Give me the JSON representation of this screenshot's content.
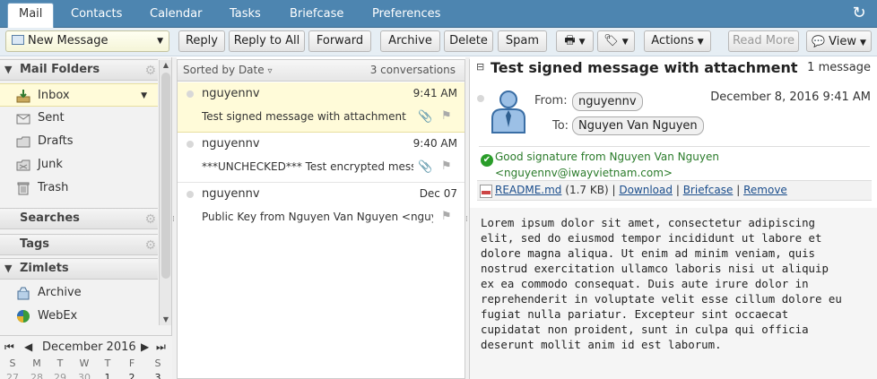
{
  "tabs": [
    "Mail",
    "Contacts",
    "Calendar",
    "Tasks",
    "Briefcase",
    "Preferences"
  ],
  "toolbar": {
    "new_message": "New Message",
    "reply": "Reply",
    "reply_all": "Reply to All",
    "forward": "Forward",
    "archive": "Archive",
    "delete": "Delete",
    "spam": "Spam",
    "actions": "Actions",
    "read_more": "Read More",
    "view": "View"
  },
  "sidebar": {
    "mail_folders": "Mail Folders",
    "folders": [
      {
        "label": "Inbox",
        "icon": "inbox-icon"
      },
      {
        "label": "Sent",
        "icon": "sent-icon"
      },
      {
        "label": "Drafts",
        "icon": "drafts-icon"
      },
      {
        "label": "Junk",
        "icon": "junk-icon"
      },
      {
        "label": "Trash",
        "icon": "trash-icon"
      }
    ],
    "searches": "Searches",
    "tags": "Tags",
    "zimlets": "Zimlets",
    "zimlet_items": [
      {
        "label": "Archive",
        "icon": "archive-zimlet-icon"
      },
      {
        "label": "WebEx",
        "icon": "webex-icon"
      }
    ]
  },
  "calendar": {
    "month": "December 2016",
    "days": [
      "S",
      "M",
      "T",
      "W",
      "T",
      "F",
      "S"
    ],
    "first_row": [
      "27",
      "28",
      "29",
      "30",
      "1",
      "2",
      "3"
    ]
  },
  "list": {
    "sort_label": "Sorted by Date",
    "count": "3 conversations",
    "messages": [
      {
        "from": "nguyennv",
        "time": "9:41 AM",
        "subject": "Test signed message with attachment",
        "attachment": true
      },
      {
        "from": "nguyennv",
        "time": "9:40 AM",
        "subject": "***UNCHECKED*** Test encrypted message with attachment",
        "attachment": true
      },
      {
        "from": "nguyennv",
        "time": "Dec 07",
        "subject": "Public Key from Nguyen Van Nguyen <nguyennv@iwayvietnam.com>",
        "attachment": false
      }
    ]
  },
  "reading": {
    "title": "Test signed message with attachment",
    "message_count": "1 message",
    "from_label": "From:",
    "from": "nguyennv",
    "to_label": "To:",
    "to": "Nguyen Van Nguyen",
    "date": "December 8, 2016 9:41 AM",
    "signature_line1": "Good signature from Nguyen Van Nguyen",
    "signature_line2": "<nguyennv@iwayvietnam.com>",
    "attachment_name": "README.md",
    "attachment_size": "(1.7 KB)",
    "download": "Download",
    "briefcase": "Briefcase",
    "remove": "Remove",
    "body": "Lorem ipsum dolor sit amet, consectetur adipiscing\nelit, sed do eiusmod tempor incididunt ut labore et\ndolore magna aliqua. Ut enim ad minim veniam, quis\nnostrud exercitation ullamco laboris nisi ut aliquip\nex ea commodo consequat. Duis aute irure dolor in\nreprehenderit in voluptate velit esse cillum dolore eu\nfugiat nulla pariatur. Excepteur sint occaecat\ncupidatat non proident, sunt in culpa qui officia\ndeserunt mollit anim id est laborum."
  },
  "colors": {
    "accent": "#4d85b0",
    "selection": "#fffbd9",
    "signature_green": "#2a7b2a",
    "link": "#1a4d8c"
  }
}
